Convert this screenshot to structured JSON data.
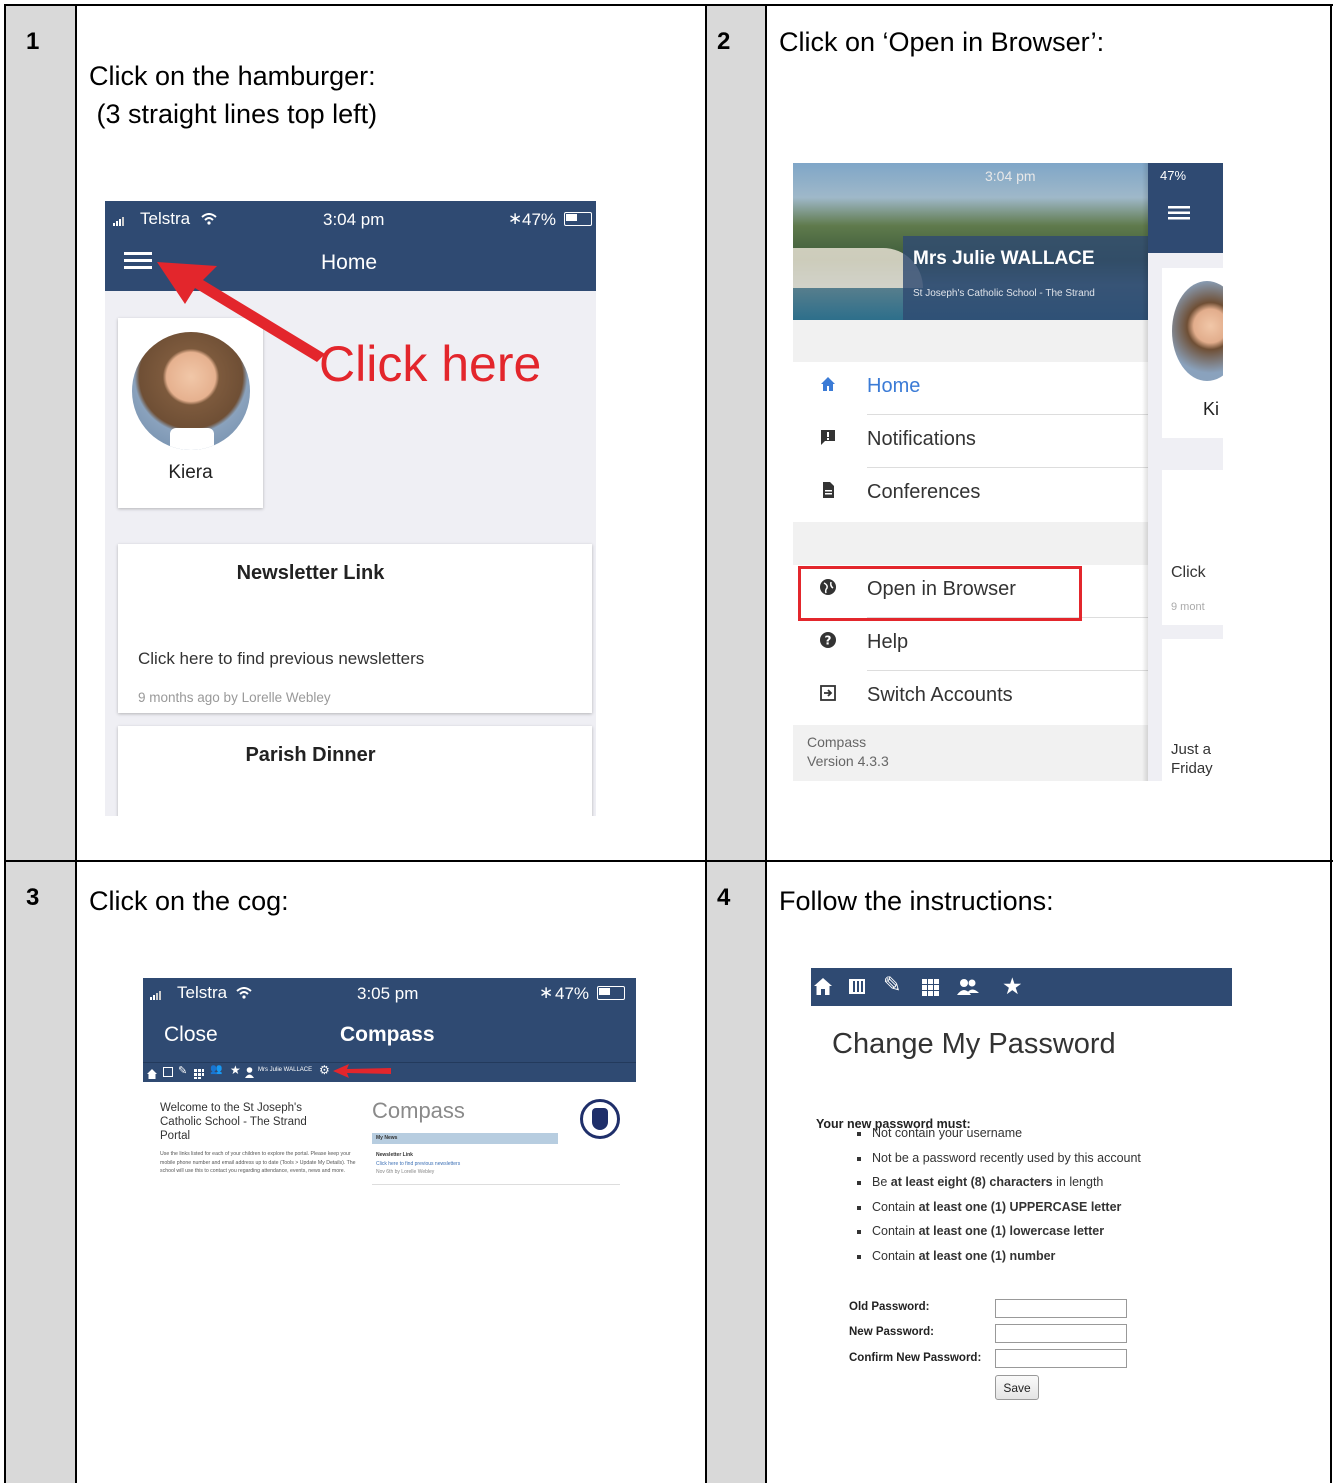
{
  "steps": [
    {
      "num": "1",
      "text_line1": "Click on the hamburger:",
      "text_line2": " (3 straight lines top left)"
    },
    {
      "num": "2",
      "text": "Click on ‘Open in Browser’:"
    },
    {
      "num": "3",
      "text": "Click on the cog:"
    },
    {
      "num": "4",
      "text": "Follow the instructions:"
    }
  ],
  "shot1": {
    "carrier": "Telstra",
    "time": "3:04 pm",
    "battery": "47%",
    "title": "Home",
    "annotation": "Click here",
    "student_name": "Kiera",
    "newsletter": {
      "title": "Newsletter Link",
      "body": "Click here to find previous newsletters",
      "meta": "9 months ago by Lorelle Webley"
    },
    "parish": {
      "title": "Parish Dinner"
    }
  },
  "shot2": {
    "time": "3:04 pm",
    "battery": "47%",
    "user_name": "Mrs Julie WALLACE",
    "school": "St Joseph's Catholic School - The Strand",
    "menu": [
      {
        "icon": "home-icon",
        "label": "Home"
      },
      {
        "icon": "notification-icon",
        "label": "Notifications"
      },
      {
        "icon": "document-icon",
        "label": "Conferences"
      },
      {
        "icon": "globe-icon",
        "label": "Open in Browser"
      },
      {
        "icon": "help-icon",
        "label": "Help"
      },
      {
        "icon": "switch-icon",
        "label": "Switch Accounts"
      }
    ],
    "footer_app": "Compass",
    "footer_version": "Version 4.3.3",
    "peek_name": "Ki",
    "peek_click": "Click",
    "peek_meta": "9 mont",
    "peek_just": "Just a",
    "peek_friday": "Friday"
  },
  "shot3": {
    "carrier": "Telstra",
    "time": "3:05 pm",
    "battery": "47%",
    "close": "Close",
    "title": "Compass",
    "user": "Mrs Julie WALLACE",
    "welcome": "Welcome to the St Joseph's Catholic School - The Strand Portal",
    "info": "Use the links listed for each of your children to explore the portal. Please keep your mobile phone number and email address up to date (Tools > Update My Details). The school will use this to contact you regarding attendance, events, news and more.",
    "brand": "Compass",
    "my_news": "My News",
    "news_title": "Newsletter Link",
    "news_link": "Click here to find previous newsletters",
    "news_meta": "Nov 6th by Lorelle Webley"
  },
  "shot4": {
    "heading": "Change My Password",
    "must": "Your new password must:",
    "rules": [
      "Not contain your username",
      "Not be a password recently used by this account"
    ],
    "rule3": {
      "a": "Be ",
      "b": "at least eight (8) characters",
      "c": " in length"
    },
    "rule4": {
      "a": "Contain ",
      "b": "at least one (1) UPPERCASE letter"
    },
    "rule5": {
      "a": "Contain ",
      "b": "at least one (1) lowercase letter"
    },
    "rule6": {
      "a": "Contain ",
      "b": "at least one (1) number"
    },
    "old_label": "Old Password:",
    "new_label": "New Password:",
    "confirm_label": "Confirm New Password:",
    "save": "Save"
  },
  "colors": {
    "navy": "#2f4a72",
    "red": "#e3262c",
    "step_bg": "#d9d9d9"
  }
}
